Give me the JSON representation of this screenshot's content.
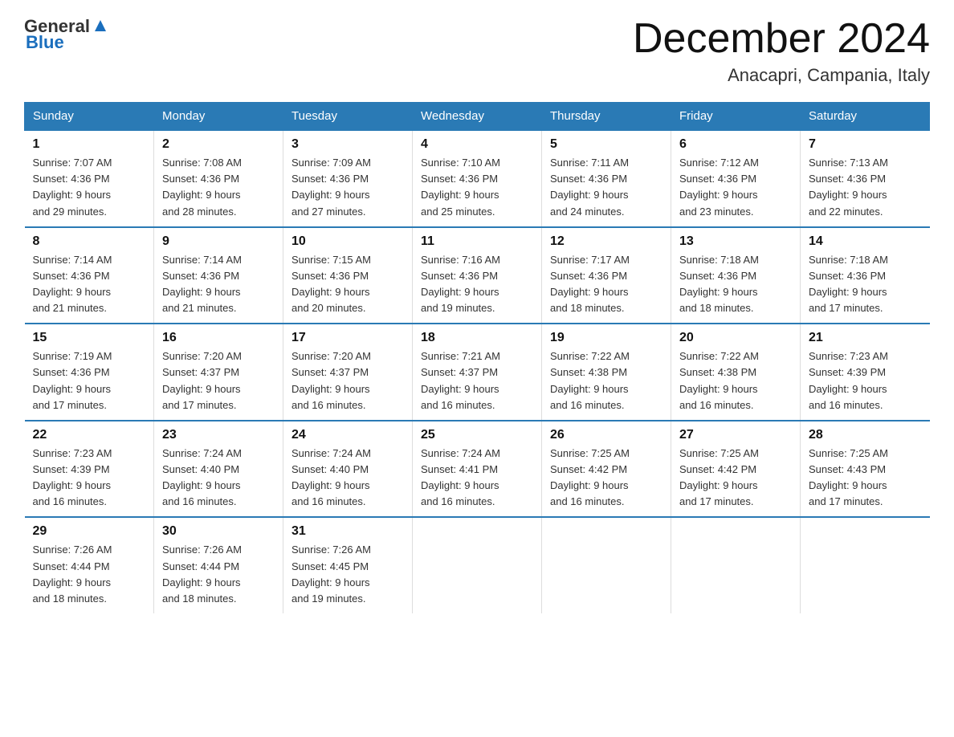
{
  "logo": {
    "text_general": "General",
    "text_blue": "Blue"
  },
  "header": {
    "month": "December 2024",
    "location": "Anacapri, Campania, Italy"
  },
  "days_of_week": [
    "Sunday",
    "Monday",
    "Tuesday",
    "Wednesday",
    "Thursday",
    "Friday",
    "Saturday"
  ],
  "weeks": [
    [
      {
        "day": "1",
        "sunrise": "7:07 AM",
        "sunset": "4:36 PM",
        "daylight": "9 hours and 29 minutes."
      },
      {
        "day": "2",
        "sunrise": "7:08 AM",
        "sunset": "4:36 PM",
        "daylight": "9 hours and 28 minutes."
      },
      {
        "day": "3",
        "sunrise": "7:09 AM",
        "sunset": "4:36 PM",
        "daylight": "9 hours and 27 minutes."
      },
      {
        "day": "4",
        "sunrise": "7:10 AM",
        "sunset": "4:36 PM",
        "daylight": "9 hours and 25 minutes."
      },
      {
        "day": "5",
        "sunrise": "7:11 AM",
        "sunset": "4:36 PM",
        "daylight": "9 hours and 24 minutes."
      },
      {
        "day": "6",
        "sunrise": "7:12 AM",
        "sunset": "4:36 PM",
        "daylight": "9 hours and 23 minutes."
      },
      {
        "day": "7",
        "sunrise": "7:13 AM",
        "sunset": "4:36 PM",
        "daylight": "9 hours and 22 minutes."
      }
    ],
    [
      {
        "day": "8",
        "sunrise": "7:14 AM",
        "sunset": "4:36 PM",
        "daylight": "9 hours and 21 minutes."
      },
      {
        "day": "9",
        "sunrise": "7:14 AM",
        "sunset": "4:36 PM",
        "daylight": "9 hours and 21 minutes."
      },
      {
        "day": "10",
        "sunrise": "7:15 AM",
        "sunset": "4:36 PM",
        "daylight": "9 hours and 20 minutes."
      },
      {
        "day": "11",
        "sunrise": "7:16 AM",
        "sunset": "4:36 PM",
        "daylight": "9 hours and 19 minutes."
      },
      {
        "day": "12",
        "sunrise": "7:17 AM",
        "sunset": "4:36 PM",
        "daylight": "9 hours and 18 minutes."
      },
      {
        "day": "13",
        "sunrise": "7:18 AM",
        "sunset": "4:36 PM",
        "daylight": "9 hours and 18 minutes."
      },
      {
        "day": "14",
        "sunrise": "7:18 AM",
        "sunset": "4:36 PM",
        "daylight": "9 hours and 17 minutes."
      }
    ],
    [
      {
        "day": "15",
        "sunrise": "7:19 AM",
        "sunset": "4:36 PM",
        "daylight": "9 hours and 17 minutes."
      },
      {
        "day": "16",
        "sunrise": "7:20 AM",
        "sunset": "4:37 PM",
        "daylight": "9 hours and 17 minutes."
      },
      {
        "day": "17",
        "sunrise": "7:20 AM",
        "sunset": "4:37 PM",
        "daylight": "9 hours and 16 minutes."
      },
      {
        "day": "18",
        "sunrise": "7:21 AM",
        "sunset": "4:37 PM",
        "daylight": "9 hours and 16 minutes."
      },
      {
        "day": "19",
        "sunrise": "7:22 AM",
        "sunset": "4:38 PM",
        "daylight": "9 hours and 16 minutes."
      },
      {
        "day": "20",
        "sunrise": "7:22 AM",
        "sunset": "4:38 PM",
        "daylight": "9 hours and 16 minutes."
      },
      {
        "day": "21",
        "sunrise": "7:23 AM",
        "sunset": "4:39 PM",
        "daylight": "9 hours and 16 minutes."
      }
    ],
    [
      {
        "day": "22",
        "sunrise": "7:23 AM",
        "sunset": "4:39 PM",
        "daylight": "9 hours and 16 minutes."
      },
      {
        "day": "23",
        "sunrise": "7:24 AM",
        "sunset": "4:40 PM",
        "daylight": "9 hours and 16 minutes."
      },
      {
        "day": "24",
        "sunrise": "7:24 AM",
        "sunset": "4:40 PM",
        "daylight": "9 hours and 16 minutes."
      },
      {
        "day": "25",
        "sunrise": "7:24 AM",
        "sunset": "4:41 PM",
        "daylight": "9 hours and 16 minutes."
      },
      {
        "day": "26",
        "sunrise": "7:25 AM",
        "sunset": "4:42 PM",
        "daylight": "9 hours and 16 minutes."
      },
      {
        "day": "27",
        "sunrise": "7:25 AM",
        "sunset": "4:42 PM",
        "daylight": "9 hours and 17 minutes."
      },
      {
        "day": "28",
        "sunrise": "7:25 AM",
        "sunset": "4:43 PM",
        "daylight": "9 hours and 17 minutes."
      }
    ],
    [
      {
        "day": "29",
        "sunrise": "7:26 AM",
        "sunset": "4:44 PM",
        "daylight": "9 hours and 18 minutes."
      },
      {
        "day": "30",
        "sunrise": "7:26 AM",
        "sunset": "4:44 PM",
        "daylight": "9 hours and 18 minutes."
      },
      {
        "day": "31",
        "sunrise": "7:26 AM",
        "sunset": "4:45 PM",
        "daylight": "9 hours and 19 minutes."
      },
      null,
      null,
      null,
      null
    ]
  ],
  "labels": {
    "sunrise": "Sunrise:",
    "sunset": "Sunset:",
    "daylight": "Daylight:"
  }
}
